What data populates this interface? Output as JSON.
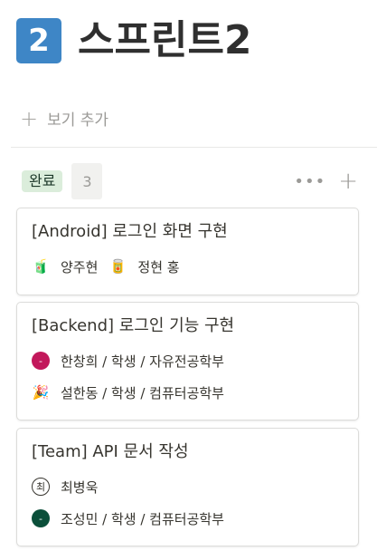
{
  "page": {
    "icon_text": "2",
    "title": "스프린트2"
  },
  "toolbar": {
    "add_view_label": "보기 추가"
  },
  "group": {
    "status_label": "완료",
    "count": "3"
  },
  "cards": [
    {
      "title": "[Android] 로그인 화면 구현",
      "people": [
        {
          "name": "양주현",
          "avatar": "🧃"
        },
        {
          "name": "정현 홍",
          "avatar": "🥫"
        }
      ]
    },
    {
      "title": "[Backend] 로그인 기능 구현",
      "people": [
        {
          "name": "한창희 / 학생 / 자유전공학부",
          "avatar_text": "-",
          "avatar_color": "#c2185b"
        },
        {
          "name": "설한동 / 학생 / 컴퓨터공학부",
          "avatar": "🎉"
        }
      ]
    },
    {
      "title": "[Team] API 문서 작성",
      "people": [
        {
          "name": "최병욱",
          "avatar_text": "최"
        },
        {
          "name": "조성민 / 학생 / 컴퓨터공학부",
          "avatar_text": "-",
          "avatar_color": "#0b4f3a"
        }
      ]
    }
  ],
  "colors": {
    "icon_bg": "#3e86c6",
    "status_bg": "#dbeddb"
  }
}
